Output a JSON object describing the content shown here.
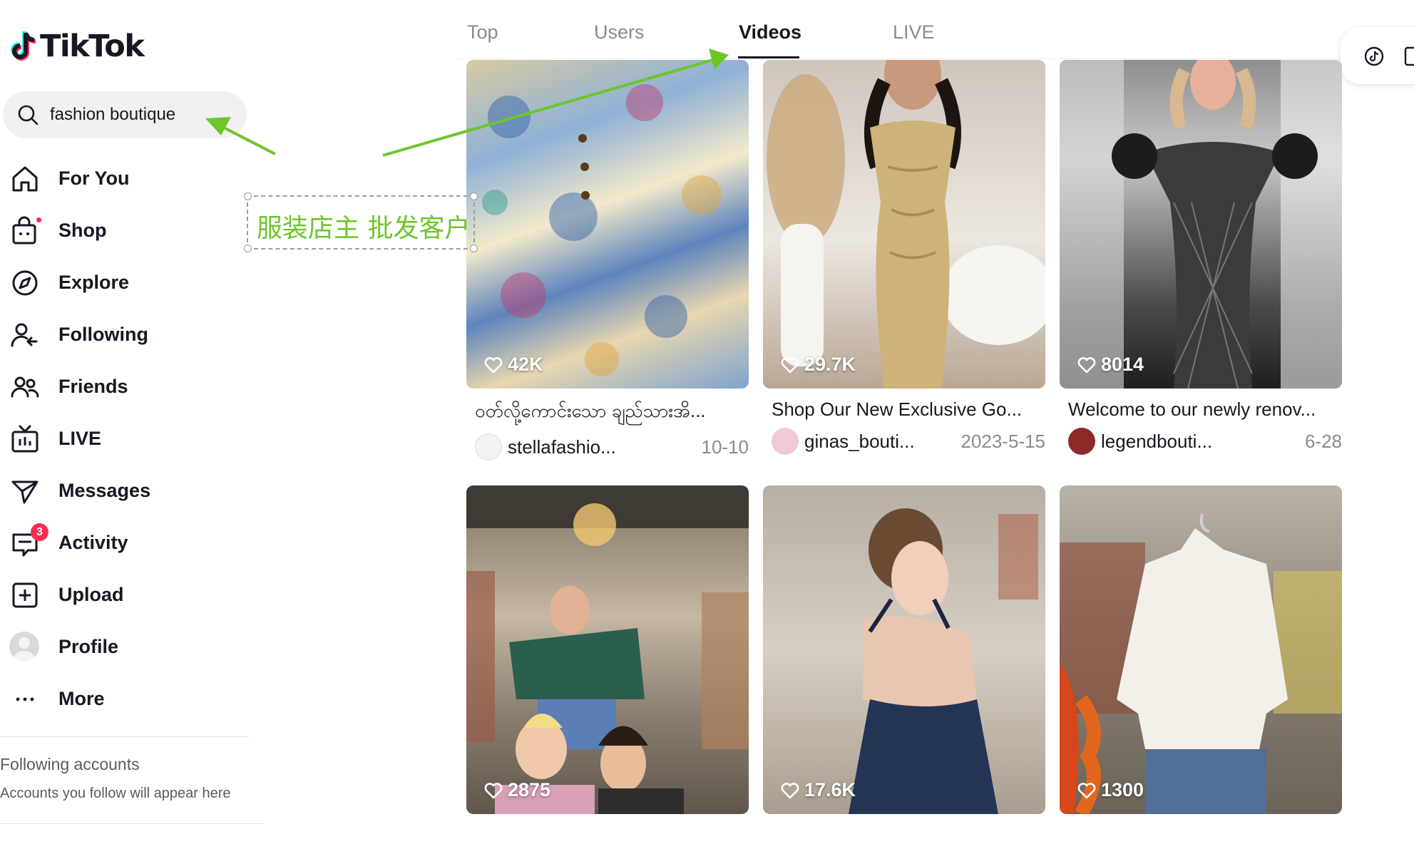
{
  "app": {
    "name": "TikTok"
  },
  "search": {
    "query": "fashion boutique"
  },
  "sidebar": {
    "items": [
      {
        "label": "For You",
        "icon": "home-icon"
      },
      {
        "label": "Shop",
        "icon": "shopping-bag-icon"
      },
      {
        "label": "Explore",
        "icon": "compass-icon"
      },
      {
        "label": "Following",
        "icon": "following-icon"
      },
      {
        "label": "Friends",
        "icon": "friends-icon"
      },
      {
        "label": "LIVE",
        "icon": "live-tv-icon"
      },
      {
        "label": "Messages",
        "icon": "send-icon"
      },
      {
        "label": "Activity",
        "icon": "activity-icon",
        "badge": "3"
      },
      {
        "label": "Upload",
        "icon": "plus-square-icon"
      },
      {
        "label": "Profile",
        "icon": "avatar"
      },
      {
        "label": "More",
        "icon": "more-icon"
      }
    ],
    "following_title": "Following accounts",
    "following_sub": "Accounts you follow will appear here"
  },
  "annotation": {
    "text": "服装店主 批发客户",
    "color": "#6dc52b"
  },
  "tabs": [
    {
      "label": "Top"
    },
    {
      "label": "Users"
    },
    {
      "label": "Videos",
      "active": true
    },
    {
      "label": "LIVE"
    }
  ],
  "videos": [
    {
      "likes": "42K",
      "desc": "ဝတ်လို့ကောင်းသော ချည်သားအိ...",
      "user": "stellafashio...",
      "date": "10-10"
    },
    {
      "likes": "29.7K",
      "desc": "Shop Our New Exclusive Go...",
      "user": "ginas_bouti...",
      "date": "2023-5-15"
    },
    {
      "likes": "8014",
      "desc": "Welcome to our newly renov...",
      "user": "legendbouti...",
      "date": "6-28"
    },
    {
      "likes": "2875"
    },
    {
      "likes": "17.6K"
    },
    {
      "likes": "1300"
    }
  ],
  "colors": {
    "accent": "#fe2c55",
    "annotation_green": "#6dc52b",
    "text": "#161823",
    "muted": "#8a8b91"
  }
}
